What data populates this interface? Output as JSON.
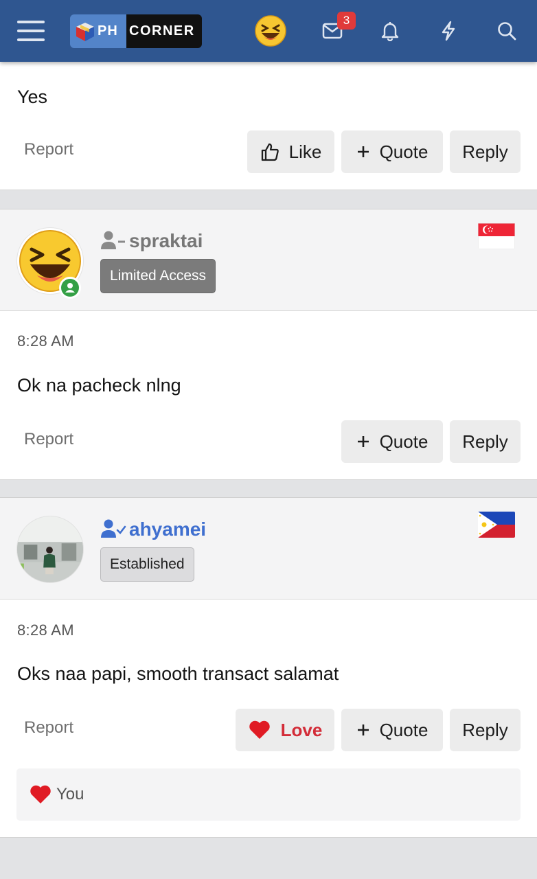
{
  "header": {
    "logo_ph": "PH",
    "logo_corner": "CORNER",
    "inbox_count": "3",
    "icons": [
      "hamburger-menu-icon",
      "laughing-emoji-icon",
      "envelope-icon",
      "bell-icon",
      "lightning-icon",
      "search-icon"
    ],
    "background_color": "#2f5690"
  },
  "posts": [
    {
      "message": "Yes",
      "report_label": "Report",
      "like_label": "Like",
      "quote_label": "Quote",
      "reply_label": "Reply"
    },
    {
      "username": "spraktai",
      "rank": "Limited Access",
      "time": "8:28 AM",
      "message": "Ok na pacheck nlng",
      "report_label": "Report",
      "quote_label": "Quote",
      "reply_label": "Reply",
      "flag": "singapore-flag",
      "online": true
    },
    {
      "username": "ahyamei",
      "rank": "Established",
      "time": "8:28 AM",
      "message": "Oks naa papi, smooth transact salamat",
      "report_label": "Report",
      "love_label": "Love",
      "quote_label": "Quote",
      "reply_label": "Reply",
      "flag": "philippines-flag",
      "reactions_by": "You"
    }
  ],
  "colors": {
    "love": "#d32c38",
    "username_member": "#3f6fcf",
    "username_limited": "#777777",
    "rank_limited_bg": "#7b7b7b",
    "rank_established_bg": "#dcdcde"
  }
}
